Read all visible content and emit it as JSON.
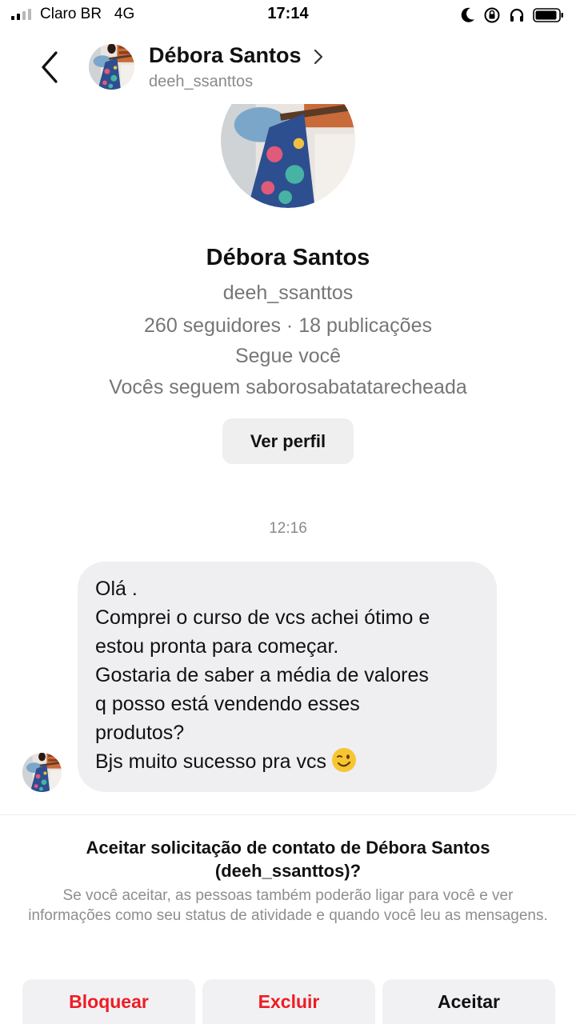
{
  "status_bar": {
    "carrier": "Claro BR",
    "network": "4G",
    "time": "17:14",
    "icons": [
      "signal-icon",
      "moon-icon",
      "rotation-lock-icon",
      "headphones-icon",
      "battery-icon"
    ]
  },
  "header": {
    "name": "Débora Santos",
    "username": "deeh_ssanttos",
    "icons": [
      "back-chevron-icon",
      "chevron-right-icon"
    ]
  },
  "profile": {
    "name": "Débora Santos",
    "username": "deeh_ssanttos",
    "stats": "260 seguidores · 18 publicações",
    "follows_you": "Segue você",
    "mutual": "Vocês seguem saborosabatatarecheada",
    "view_profile_label": "Ver perfil"
  },
  "conversation": {
    "timestamp": "12:16",
    "message_lines": [
      "Olá .",
      "Comprei o curso de vcs achei ótimo e",
      "estou pronta para começar.",
      "Gostaria de saber a média de valores",
      "q posso está vendendo esses",
      "produtos?",
      "Bjs muito sucesso pra vcs"
    ],
    "emoji": "winking-face-emoji"
  },
  "request": {
    "title": "Aceitar solicitação de contato de Débora Santos (deeh_ssanttos)?",
    "description": "Se você aceitar, as pessoas também poderão ligar para você e ver informações como seu status de atividade e quando você leu as mensagens.",
    "buttons": {
      "block": "Bloquear",
      "delete": "Excluir",
      "accept": "Aceitar"
    }
  },
  "colors": {
    "danger": "#ed1c24",
    "bubble": "#efeff2",
    "button_bg": "#f1f1f3",
    "secondary_text": "#767676"
  }
}
